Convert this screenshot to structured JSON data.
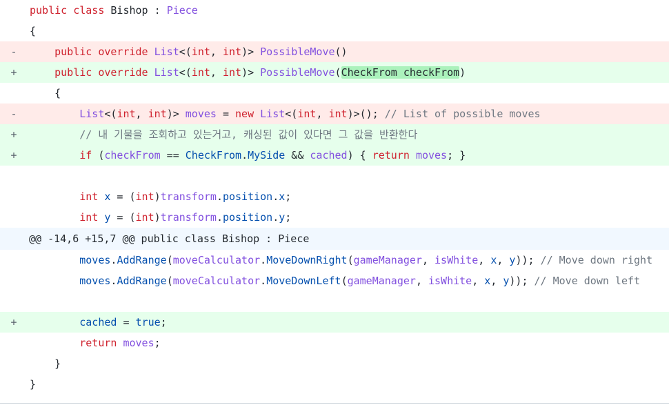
{
  "diff": {
    "lines": [
      {
        "type": "ctx",
        "marker": "",
        "parts": [
          {
            "t": "public class ",
            "c": "kw"
          },
          {
            "t": "Bishop",
            "c": "op"
          },
          {
            "t": " : ",
            "c": "op"
          },
          {
            "t": "Piece",
            "c": "ty"
          }
        ]
      },
      {
        "type": "ctx",
        "marker": "",
        "parts": [
          {
            "t": "{",
            "c": "op"
          }
        ]
      },
      {
        "type": "del",
        "marker": "-",
        "parts": [
          {
            "t": "    public override ",
            "c": "kw"
          },
          {
            "t": "List",
            "c": "ty"
          },
          {
            "t": "<(",
            "c": "op"
          },
          {
            "t": "int",
            "c": "kw"
          },
          {
            "t": ", ",
            "c": "op"
          },
          {
            "t": "int",
            "c": "kw"
          },
          {
            "t": ")> ",
            "c": "op"
          },
          {
            "t": "PossibleMove",
            "c": "fn"
          },
          {
            "t": "()",
            "c": "op"
          }
        ]
      },
      {
        "type": "add",
        "marker": "+",
        "parts": [
          {
            "t": "    public override ",
            "c": "kw"
          },
          {
            "t": "List",
            "c": "ty"
          },
          {
            "t": "<(",
            "c": "op"
          },
          {
            "t": "int",
            "c": "kw"
          },
          {
            "t": ", ",
            "c": "op"
          },
          {
            "t": "int",
            "c": "kw"
          },
          {
            "t": ")> ",
            "c": "op"
          },
          {
            "t": "PossibleMove",
            "c": "fn"
          },
          {
            "t": "(",
            "c": "op"
          },
          {
            "t": "CheckFrom checkFrom",
            "c": "hl"
          },
          {
            "t": ")",
            "c": "op"
          }
        ]
      },
      {
        "type": "ctx",
        "marker": "",
        "parts": [
          {
            "t": "    {",
            "c": "op"
          }
        ]
      },
      {
        "type": "del",
        "marker": "-",
        "parts": [
          {
            "t": "        List",
            "c": "ty"
          },
          {
            "t": "<(",
            "c": "op"
          },
          {
            "t": "int",
            "c": "kw"
          },
          {
            "t": ", ",
            "c": "op"
          },
          {
            "t": "int",
            "c": "kw"
          },
          {
            "t": ")> ",
            "c": "op"
          },
          {
            "t": "moves",
            "c": "fn"
          },
          {
            "t": " = ",
            "c": "op"
          },
          {
            "t": "new ",
            "c": "kw"
          },
          {
            "t": "List",
            "c": "ty"
          },
          {
            "t": "<(",
            "c": "op"
          },
          {
            "t": "int",
            "c": "kw"
          },
          {
            "t": ", ",
            "c": "op"
          },
          {
            "t": "int",
            "c": "kw"
          },
          {
            "t": ")>(); ",
            "c": "op"
          },
          {
            "t": "// List of possible moves",
            "c": "cm"
          }
        ]
      },
      {
        "type": "add",
        "marker": "+",
        "parts": [
          {
            "t": "        // 내 기물을 조회하고 있는거고, 캐싱된 값이 있다면 그 값을 반환한다",
            "c": "cm"
          }
        ]
      },
      {
        "type": "add",
        "marker": "+",
        "parts": [
          {
            "t": "        if",
            "c": "kw"
          },
          {
            "t": " (",
            "c": "op"
          },
          {
            "t": "checkFrom",
            "c": "fn"
          },
          {
            "t": " == ",
            "c": "op"
          },
          {
            "t": "CheckFrom",
            "c": "vr"
          },
          {
            "t": ".",
            "c": "op"
          },
          {
            "t": "MySide",
            "c": "vr"
          },
          {
            "t": " && ",
            "c": "op"
          },
          {
            "t": "cached",
            "c": "fn"
          },
          {
            "t": ") { ",
            "c": "op"
          },
          {
            "t": "return ",
            "c": "kw"
          },
          {
            "t": "moves",
            "c": "fn"
          },
          {
            "t": "; }",
            "c": "op"
          }
        ]
      },
      {
        "type": "ctx",
        "marker": "",
        "parts": []
      },
      {
        "type": "ctx",
        "marker": "",
        "parts": [
          {
            "t": "        int ",
            "c": "kw"
          },
          {
            "t": "x",
            "c": "vr"
          },
          {
            "t": " = (",
            "c": "op"
          },
          {
            "t": "int",
            "c": "kw"
          },
          {
            "t": ")",
            "c": "op"
          },
          {
            "t": "transform",
            "c": "fn"
          },
          {
            "t": ".",
            "c": "op"
          },
          {
            "t": "position",
            "c": "vr"
          },
          {
            "t": ".",
            "c": "op"
          },
          {
            "t": "x",
            "c": "vr"
          },
          {
            "t": ";",
            "c": "op"
          }
        ]
      },
      {
        "type": "ctx",
        "marker": "",
        "parts": [
          {
            "t": "        int ",
            "c": "kw"
          },
          {
            "t": "y",
            "c": "vr"
          },
          {
            "t": " = (",
            "c": "op"
          },
          {
            "t": "int",
            "c": "kw"
          },
          {
            "t": ")",
            "c": "op"
          },
          {
            "t": "transform",
            "c": "fn"
          },
          {
            "t": ".",
            "c": "op"
          },
          {
            "t": "position",
            "c": "vr"
          },
          {
            "t": ".",
            "c": "op"
          },
          {
            "t": "y",
            "c": "vr"
          },
          {
            "t": ";",
            "c": "op"
          }
        ]
      },
      {
        "type": "hunk",
        "marker": "",
        "parts": [
          {
            "t": "@@ -14,6 +15,7 @@ public class Bishop : Piece",
            "c": "op"
          }
        ]
      },
      {
        "type": "ctx",
        "marker": "",
        "parts": [
          {
            "t": "        moves",
            "c": "vr"
          },
          {
            "t": ".",
            "c": "op"
          },
          {
            "t": "AddRange",
            "c": "vr"
          },
          {
            "t": "(",
            "c": "op"
          },
          {
            "t": "moveCalculator",
            "c": "fn"
          },
          {
            "t": ".",
            "c": "op"
          },
          {
            "t": "MoveDownRight",
            "c": "vr"
          },
          {
            "t": "(",
            "c": "op"
          },
          {
            "t": "gameManager",
            "c": "fn"
          },
          {
            "t": ", ",
            "c": "op"
          },
          {
            "t": "isWhite",
            "c": "fn"
          },
          {
            "t": ", ",
            "c": "op"
          },
          {
            "t": "x",
            "c": "vr"
          },
          {
            "t": ", ",
            "c": "op"
          },
          {
            "t": "y",
            "c": "vr"
          },
          {
            "t": ")); ",
            "c": "op"
          },
          {
            "t": "// Move down right",
            "c": "cm"
          }
        ]
      },
      {
        "type": "ctx",
        "marker": "",
        "parts": [
          {
            "t": "        moves",
            "c": "vr"
          },
          {
            "t": ".",
            "c": "op"
          },
          {
            "t": "AddRange",
            "c": "vr"
          },
          {
            "t": "(",
            "c": "op"
          },
          {
            "t": "moveCalculator",
            "c": "fn"
          },
          {
            "t": ".",
            "c": "op"
          },
          {
            "t": "MoveDownLeft",
            "c": "vr"
          },
          {
            "t": "(",
            "c": "op"
          },
          {
            "t": "gameManager",
            "c": "fn"
          },
          {
            "t": ", ",
            "c": "op"
          },
          {
            "t": "isWhite",
            "c": "fn"
          },
          {
            "t": ", ",
            "c": "op"
          },
          {
            "t": "x",
            "c": "vr"
          },
          {
            "t": ", ",
            "c": "op"
          },
          {
            "t": "y",
            "c": "vr"
          },
          {
            "t": ")); ",
            "c": "op"
          },
          {
            "t": "// Move down left",
            "c": "cm"
          }
        ]
      },
      {
        "type": "ctx",
        "marker": "",
        "parts": []
      },
      {
        "type": "add",
        "marker": "+",
        "parts": [
          {
            "t": "        cached",
            "c": "vr"
          },
          {
            "t": " = ",
            "c": "op"
          },
          {
            "t": "true",
            "c": "lit"
          },
          {
            "t": ";",
            "c": "op"
          }
        ]
      },
      {
        "type": "ctx",
        "marker": "",
        "parts": [
          {
            "t": "        return ",
            "c": "kw"
          },
          {
            "t": "moves",
            "c": "fn"
          },
          {
            "t": ";",
            "c": "op"
          }
        ]
      },
      {
        "type": "ctx",
        "marker": "",
        "parts": [
          {
            "t": "    }",
            "c": "op"
          }
        ]
      },
      {
        "type": "ctx",
        "marker": "",
        "parts": [
          {
            "t": "}",
            "c": "op"
          }
        ]
      }
    ]
  }
}
